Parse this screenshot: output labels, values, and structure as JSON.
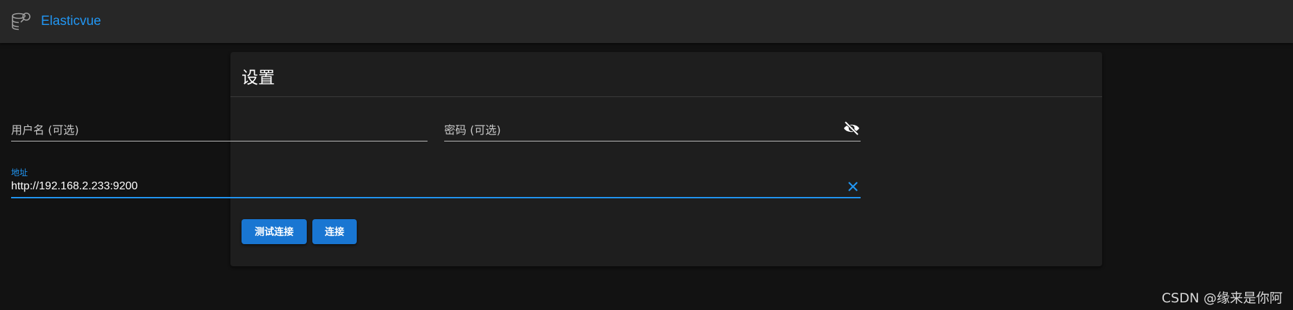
{
  "app": {
    "title": "Elasticvue",
    "logo_icon": "database-search-icon",
    "accent": "#2196f3"
  },
  "settings": {
    "title": "设置",
    "username": {
      "label": "用户名 (可选)",
      "value": ""
    },
    "password": {
      "label": "密码 (可选)",
      "value": "",
      "toggle_icon": "eye-off-icon"
    },
    "address": {
      "label": "地址",
      "value": "http://192.168.2.233:9200",
      "clear_icon": "close-icon"
    },
    "buttons": {
      "test": "测试连接",
      "connect": "连接"
    }
  },
  "watermark": "CSDN @缘来是你阿"
}
